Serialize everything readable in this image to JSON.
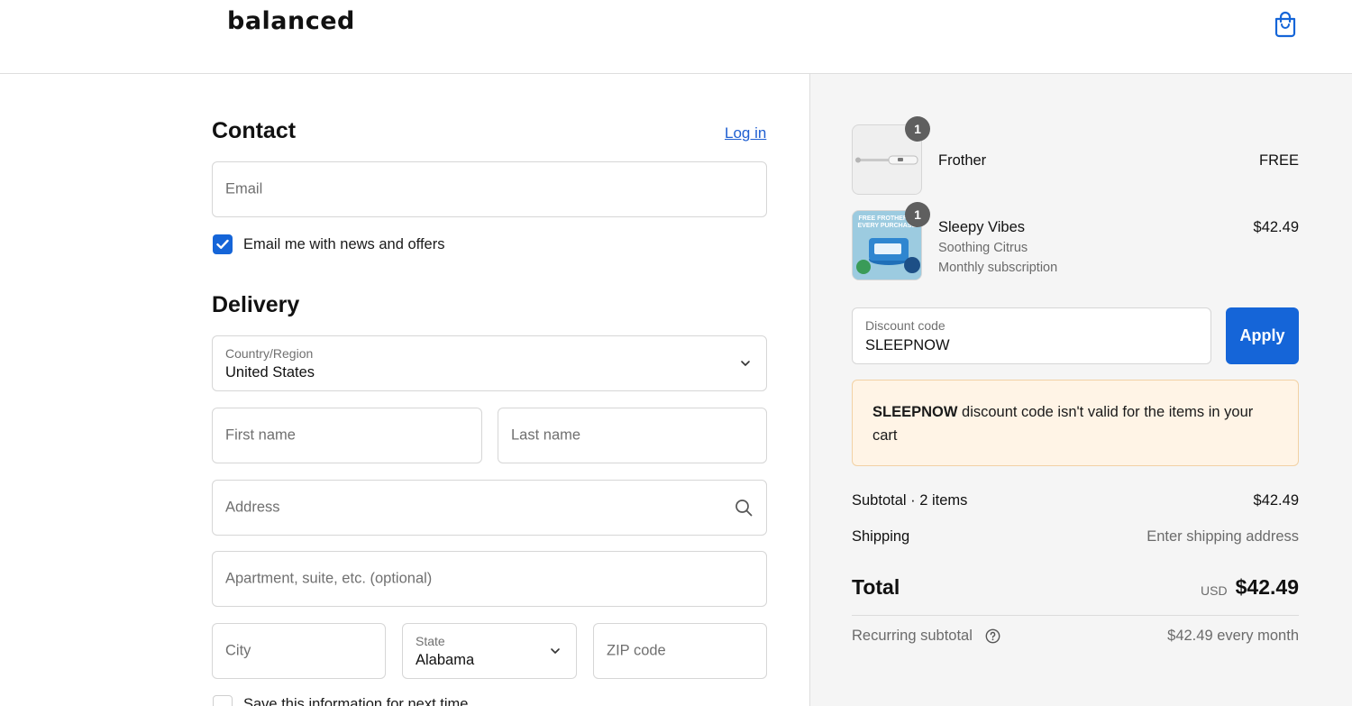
{
  "header": {
    "logo": "balanced",
    "cart_icon": "shopping-bag-icon"
  },
  "contact": {
    "title": "Contact",
    "login_link": "Log in",
    "email_placeholder": "Email",
    "newsletter_label": "Email me with news and offers",
    "newsletter_checked": true
  },
  "delivery": {
    "title": "Delivery",
    "country_label": "Country/Region",
    "country_value": "United States",
    "first_name_placeholder": "First name",
    "last_name_placeholder": "Last name",
    "address_placeholder": "Address",
    "apartment_placeholder": "Apartment, suite, etc. (optional)",
    "city_placeholder": "City",
    "state_label": "State",
    "state_value": "Alabama",
    "zip_placeholder": "ZIP code",
    "save_info_label": "Save this information for next time"
  },
  "order": {
    "items": [
      {
        "quantity": "1",
        "name": "Frother",
        "variant": "",
        "plan": "",
        "price": "FREE"
      },
      {
        "quantity": "1",
        "name": "Sleepy Vibes",
        "variant": "Soothing Citrus",
        "plan": "Monthly subscription",
        "price": "$42.49",
        "thumb_text": "FREE FROTHER W/ EVERY PURCHASE!"
      }
    ],
    "discount_label": "Discount code",
    "discount_value": "SLEEPNOW",
    "apply_label": "Apply",
    "alert_code": "SLEEPNOW",
    "alert_text": " discount code isn't valid for the items in your cart",
    "subtotal_label": "Subtotal · 2 items",
    "subtotal_value": "$42.49",
    "shipping_label": "Shipping",
    "shipping_value": "Enter shipping address",
    "total_label": "Total",
    "total_currency": "USD",
    "total_value": "$42.49",
    "recurring_label": "Recurring subtotal",
    "recurring_value": "$42.49 every month"
  },
  "colors": {
    "accent": "#1565d8",
    "alert_bg": "#fff4e6",
    "summary_bg": "#f5f5f5"
  }
}
